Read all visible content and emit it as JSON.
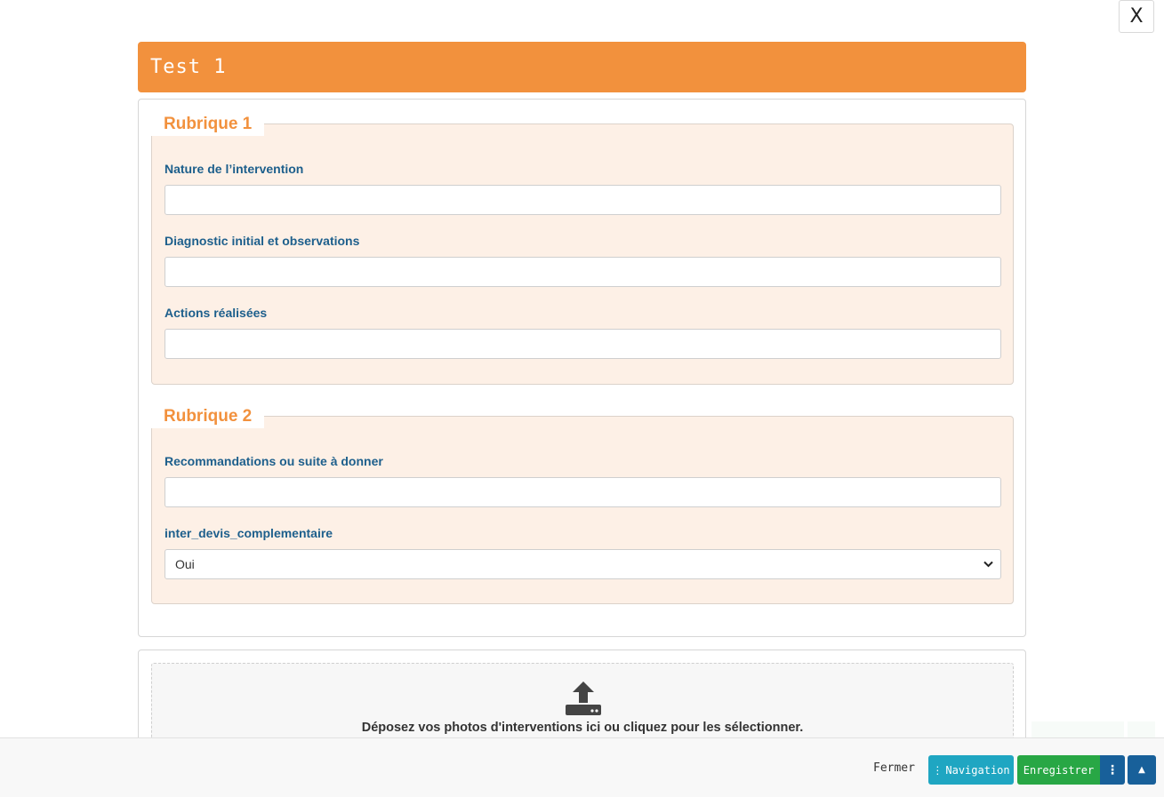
{
  "modal": {
    "close_label": "X"
  },
  "header": {
    "title": "Test 1"
  },
  "rubriques": [
    {
      "title": "Rubrique 1",
      "fields": [
        {
          "label": "Nature de l’intervention",
          "value": ""
        },
        {
          "label": "Diagnostic initial et observations",
          "value": ""
        },
        {
          "label": "Actions réalisées",
          "value": ""
        }
      ]
    },
    {
      "title": "Rubrique 2",
      "fields": [
        {
          "label": "Recommandations ou suite à donner",
          "value": ""
        },
        {
          "label": "inter_devis_complementaire",
          "value": "Oui"
        }
      ]
    }
  ],
  "upload": {
    "icon": "upload-icon",
    "text": "Déposez vos photos d'interventions ici ou cliquez pour les sélectionner."
  },
  "footer": {
    "close_label": "Fermer",
    "navigation_label": "Navigation",
    "navigation_icon": "⋮",
    "save_label": "Enregistrer",
    "save_more_icon": "⋮",
    "scroll_top_icon": "▲"
  },
  "colors": {
    "accent": "#f2913d",
    "label": "#1d5f8c",
    "fieldset_bg": "#fdf0e6",
    "nav_button": "#1fa6c2",
    "save_button": "#28a745",
    "dark_button": "#18609a"
  }
}
